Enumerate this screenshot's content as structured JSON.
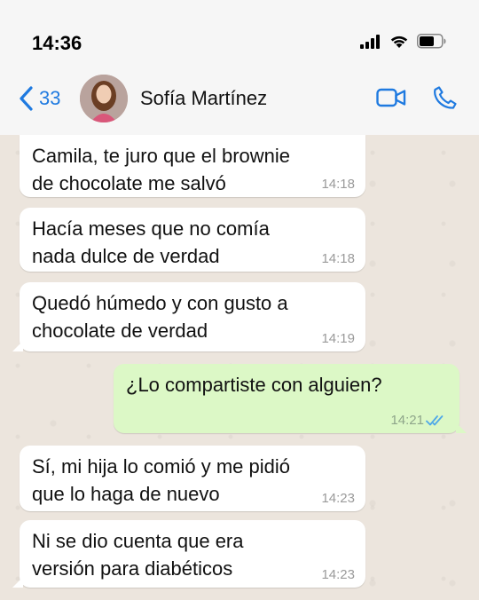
{
  "status_bar": {
    "time": "14:36"
  },
  "header": {
    "back_count": "33",
    "contact_name": "Sofía Martínez"
  },
  "messages": [
    {
      "direction": "in",
      "text": "Camila, te juro que el brownie de chocolate me salvó",
      "time": "14:18"
    },
    {
      "direction": "in",
      "text": "Hacía meses que no comía nada dulce de verdad",
      "time": "14:18"
    },
    {
      "direction": "in",
      "text": "Quedó húmedo y con gusto a chocolate de verdad",
      "time": "14:19"
    },
    {
      "direction": "out",
      "text": "¿Lo compartiste con alguien?",
      "time": "14:21",
      "read": true
    },
    {
      "direction": "in",
      "text": "Sí, mi hija lo comió y me pidió que lo haga de nuevo",
      "time": "14:23"
    },
    {
      "direction": "in",
      "text": "Ni se dio cuenta que era versión para diabéticos",
      "time": "14:23"
    }
  ],
  "colors": {
    "accent": "#1f7ae0",
    "incoming_bubble": "#ffffff",
    "outgoing_bubble": "#dcf8c6",
    "chat_background": "#ece5dd",
    "read_ticks": "#4fa8e8"
  },
  "icons": [
    "signal-icon",
    "wifi-icon",
    "battery-icon",
    "back-chevron-icon",
    "video-call-icon",
    "phone-call-icon",
    "double-check-icon"
  ]
}
